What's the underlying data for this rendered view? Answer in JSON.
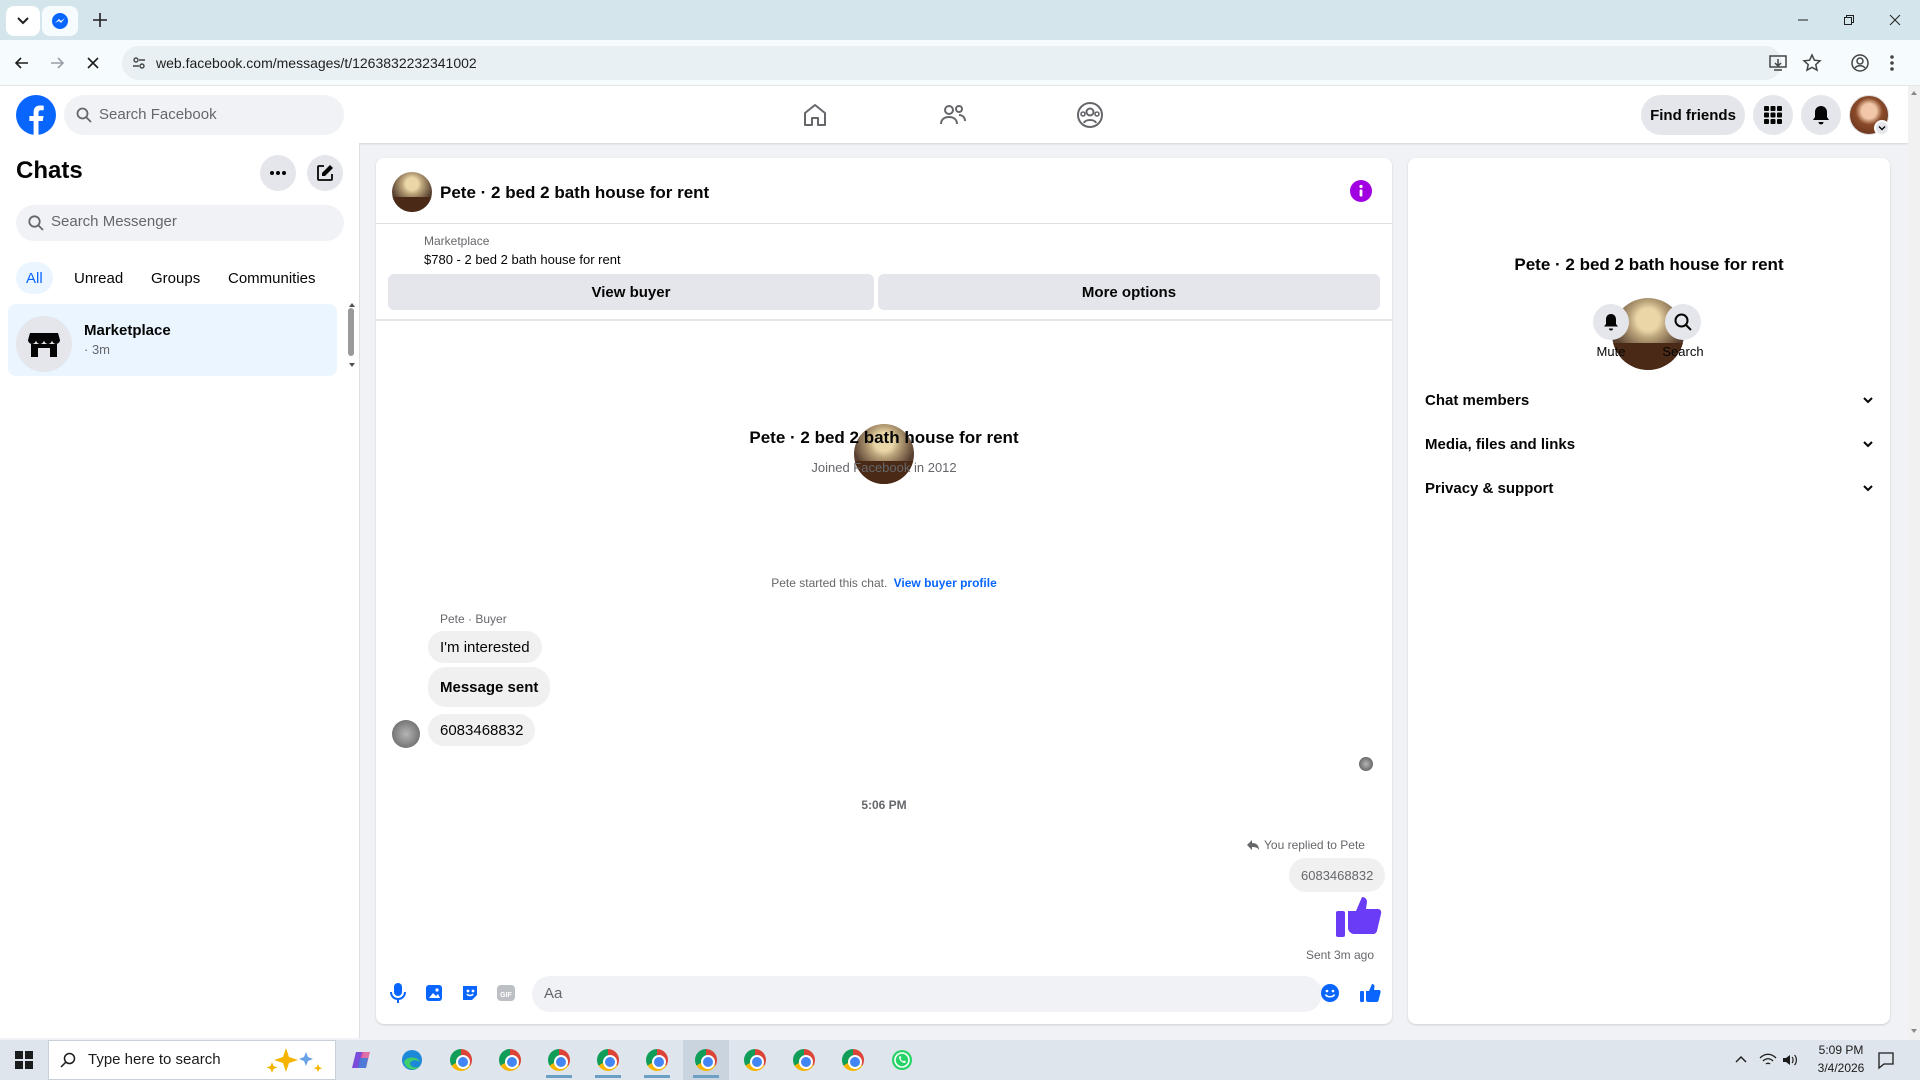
{
  "browser": {
    "url": "web.facebook.com/messages/t/1263832232341002"
  },
  "fb_header": {
    "search_placeholder": "Search Facebook",
    "find_friends": "Find friends"
  },
  "chats": {
    "title": "Chats",
    "search_placeholder": "Search Messenger",
    "filters": [
      "All",
      "Unread",
      "Groups",
      "Communities"
    ],
    "items": [
      {
        "name": "Marketplace",
        "meta": "· 3m"
      }
    ]
  },
  "conversation": {
    "header_title": "Pete · 2 bed 2 bath house for rent",
    "listing_source": "Marketplace",
    "listing_title": "$780 - 2 bed 2 bath house for rent",
    "view_buyer": "View buyer",
    "more_options": "More options",
    "profile_name": "Pete · 2 bed 2 bath house for rent",
    "profile_joined": "Joined Facebook in 2012",
    "started_text": "Pete started this chat.",
    "view_buyer_profile": "View buyer profile",
    "sender_label": "Pete · Buyer",
    "incoming": [
      "I'm interested",
      "Message sent",
      "6083468832"
    ],
    "time_divider": "5:06 PM",
    "reply_label": "You replied to Pete",
    "reply_quote": "6083468832",
    "sent_status": "Sent 3m ago",
    "composer_placeholder": "Aa"
  },
  "details": {
    "name": "Pete · 2 bed 2 bath house for rent",
    "mute": "Mute",
    "search": "Search",
    "sections": [
      "Chat members",
      "Media, files and links",
      "Privacy & support"
    ]
  },
  "taskbar": {
    "search_placeholder": "Type here to search",
    "time": "5:09 PM",
    "date": "3/4/2026"
  },
  "colors": {
    "accent_blue": "#0866ff",
    "messenger_purple": "#6b3cf5"
  }
}
